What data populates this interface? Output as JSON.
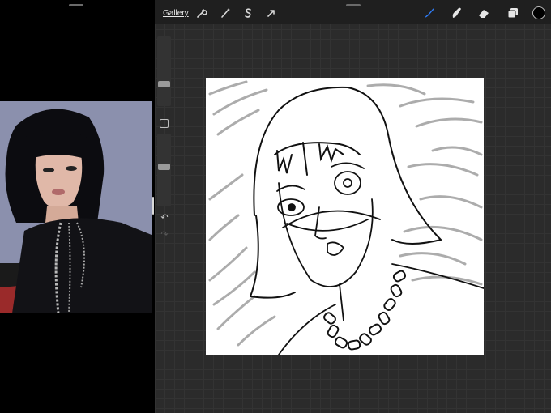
{
  "toolbar": {
    "gallery_label": "Gallery",
    "actions": [
      {
        "name": "wrench-icon",
        "tool": "actions"
      },
      {
        "name": "magic-wand-icon",
        "tool": "adjustments"
      },
      {
        "name": "selection-s-icon",
        "tool": "selection"
      },
      {
        "name": "arrow-cursor-icon",
        "tool": "transform"
      }
    ],
    "tools": [
      {
        "name": "brush-icon",
        "tool": "paint",
        "active": true
      },
      {
        "name": "smudge-icon",
        "tool": "smudge",
        "active": false
      },
      {
        "name": "eraser-icon",
        "tool": "erase",
        "active": false
      },
      {
        "name": "layers-icon",
        "tool": "layers",
        "active": false
      }
    ],
    "active_color": "#000000",
    "accent_color": "#2f7cf6"
  },
  "sidebar": {
    "brush_size_level": 0.3,
    "opacity_level": 0.55
  },
  "reference": {
    "description_icon": "reference-photo"
  }
}
